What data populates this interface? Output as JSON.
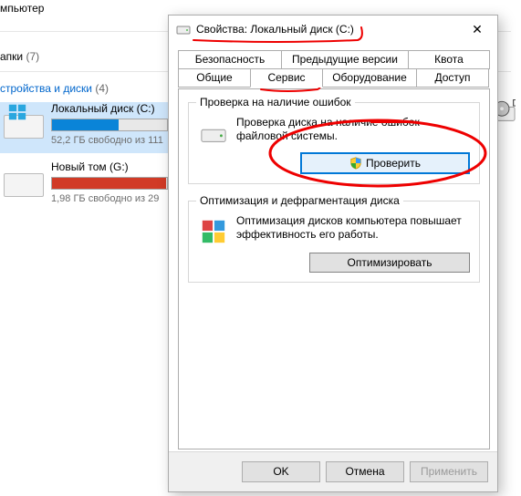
{
  "explorer": {
    "heading_computer": "мпьютер",
    "folders_label": "апки",
    "folders_count": "(7)",
    "devices_label": "стройства и диски",
    "devices_count": "(4)",
    "drives": {
      "c": {
        "name": "Локальный диск (C:)",
        "sub": "52,2 ГБ свободно из 111"
      },
      "g": {
        "name": "Новый том (G:)",
        "sub": "1,98 ГБ свободно из 29"
      }
    },
    "dvd_label": "D"
  },
  "dialog": {
    "title": "Свойства: Локальный диск (C:)",
    "tabs_row1": [
      "Безопасность",
      "Предыдущие версии",
      "Квота"
    ],
    "tabs_row2": [
      "Общие",
      "Сервис",
      "Оборудование",
      "Доступ"
    ],
    "groups": {
      "check": {
        "legend": "Проверка на наличие ошибок",
        "desc": "Проверка диска на наличие ошибок файловой системы.",
        "button": "Проверить"
      },
      "defrag": {
        "legend": "Оптимизация и дефрагментация диска",
        "desc": "Оптимизация дисков компьютера повышает эффективность его работы.",
        "button": "Оптимизировать"
      }
    },
    "buttons": {
      "ok": "OK",
      "cancel": "Отмена",
      "apply": "Применить"
    }
  }
}
